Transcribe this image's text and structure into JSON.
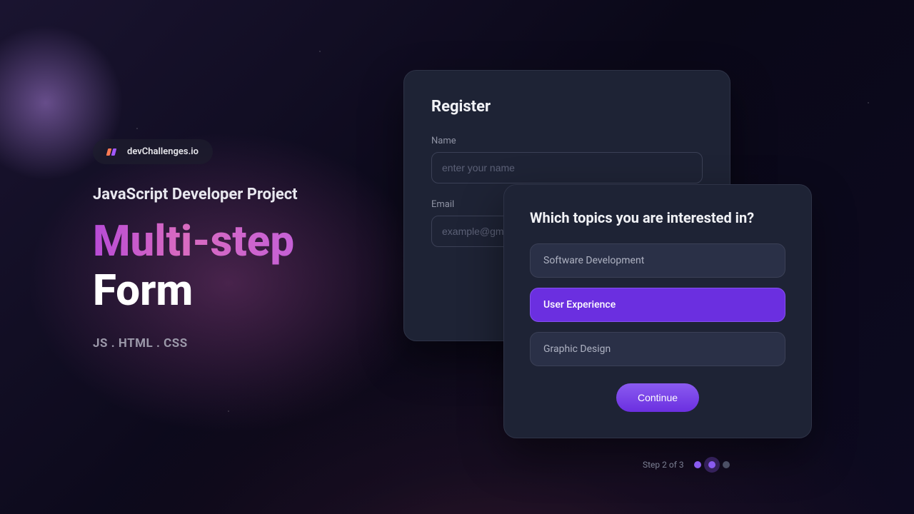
{
  "badge": {
    "text": "devChallenges.io"
  },
  "subtitle": "JavaScript Developer Project",
  "title": {
    "line1": "Multi-step",
    "line2": "Form"
  },
  "tech": "JS . HTML . CSS",
  "register": {
    "heading": "Register",
    "name_label": "Name",
    "name_placeholder": "enter your name",
    "email_label": "Email",
    "email_placeholder": "example@gmail.com"
  },
  "topics": {
    "heading": "Which topics you are interested in?",
    "options": [
      "Software Development",
      "User Experience",
      "Graphic Design"
    ],
    "selected_index": 1,
    "continue_label": "Continue"
  },
  "stepper": {
    "label": "Step 2 of 3",
    "total": 3,
    "current": 2
  }
}
